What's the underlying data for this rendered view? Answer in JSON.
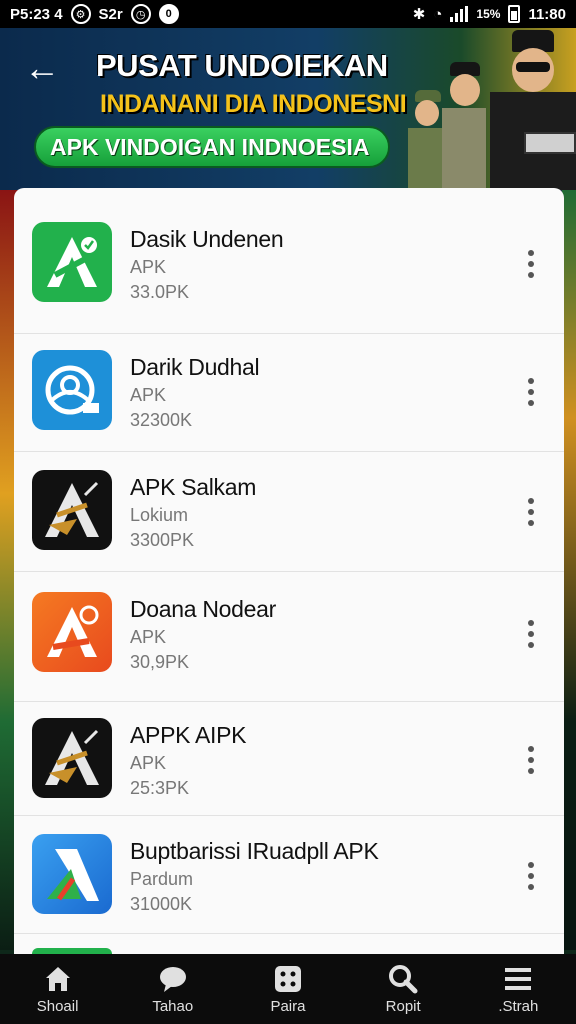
{
  "status_bar": {
    "time_left": "P5:23 4",
    "carrier": "S2r",
    "battery_pct": "15%",
    "clock": "11:80"
  },
  "header": {
    "back_label": "←",
    "title": "PUSAT UNDOIEKAN",
    "subtitle": "INDANANI DIA INDONESNI",
    "pill": "APK VINDOIGAN INDNOESIA"
  },
  "apps": [
    {
      "name": "Dasik Undenen",
      "type": "APK",
      "size": "33.0PK",
      "icon": "green-a-icon",
      "color": "#22b14c"
    },
    {
      "name": "Darik Dudhal",
      "type": "APK",
      "size": "32300K",
      "icon": "blue-globe-icon",
      "color": "#1e90d8"
    },
    {
      "name": "APK Salkam",
      "type": "Lokium",
      "size": "3300PK",
      "icon": "dark-a-icon",
      "color": "#111111"
    },
    {
      "name": "Doana Nodear",
      "type": "APK",
      "size": "30,9PK",
      "icon": "orange-a-icon",
      "color": "#f05a22"
    },
    {
      "name": "APPK AIPK",
      "type": "APK",
      "size": "25:3PK",
      "icon": "dark-a-icon",
      "color": "#111111"
    },
    {
      "name": "Buptbarissi IRuadpll APK",
      "type": "Pardum",
      "size": "31000K",
      "icon": "blue-a-icon",
      "color": "#2a7fd6"
    }
  ],
  "nav": [
    {
      "label": "Shoail",
      "icon": "home-icon"
    },
    {
      "label": "Tahao",
      "icon": "chat-icon"
    },
    {
      "label": "Paira",
      "icon": "apps-icon"
    },
    {
      "label": "Ropit",
      "icon": "search-icon"
    },
    {
      "label": ".Strah",
      "icon": "menu-icon"
    }
  ]
}
